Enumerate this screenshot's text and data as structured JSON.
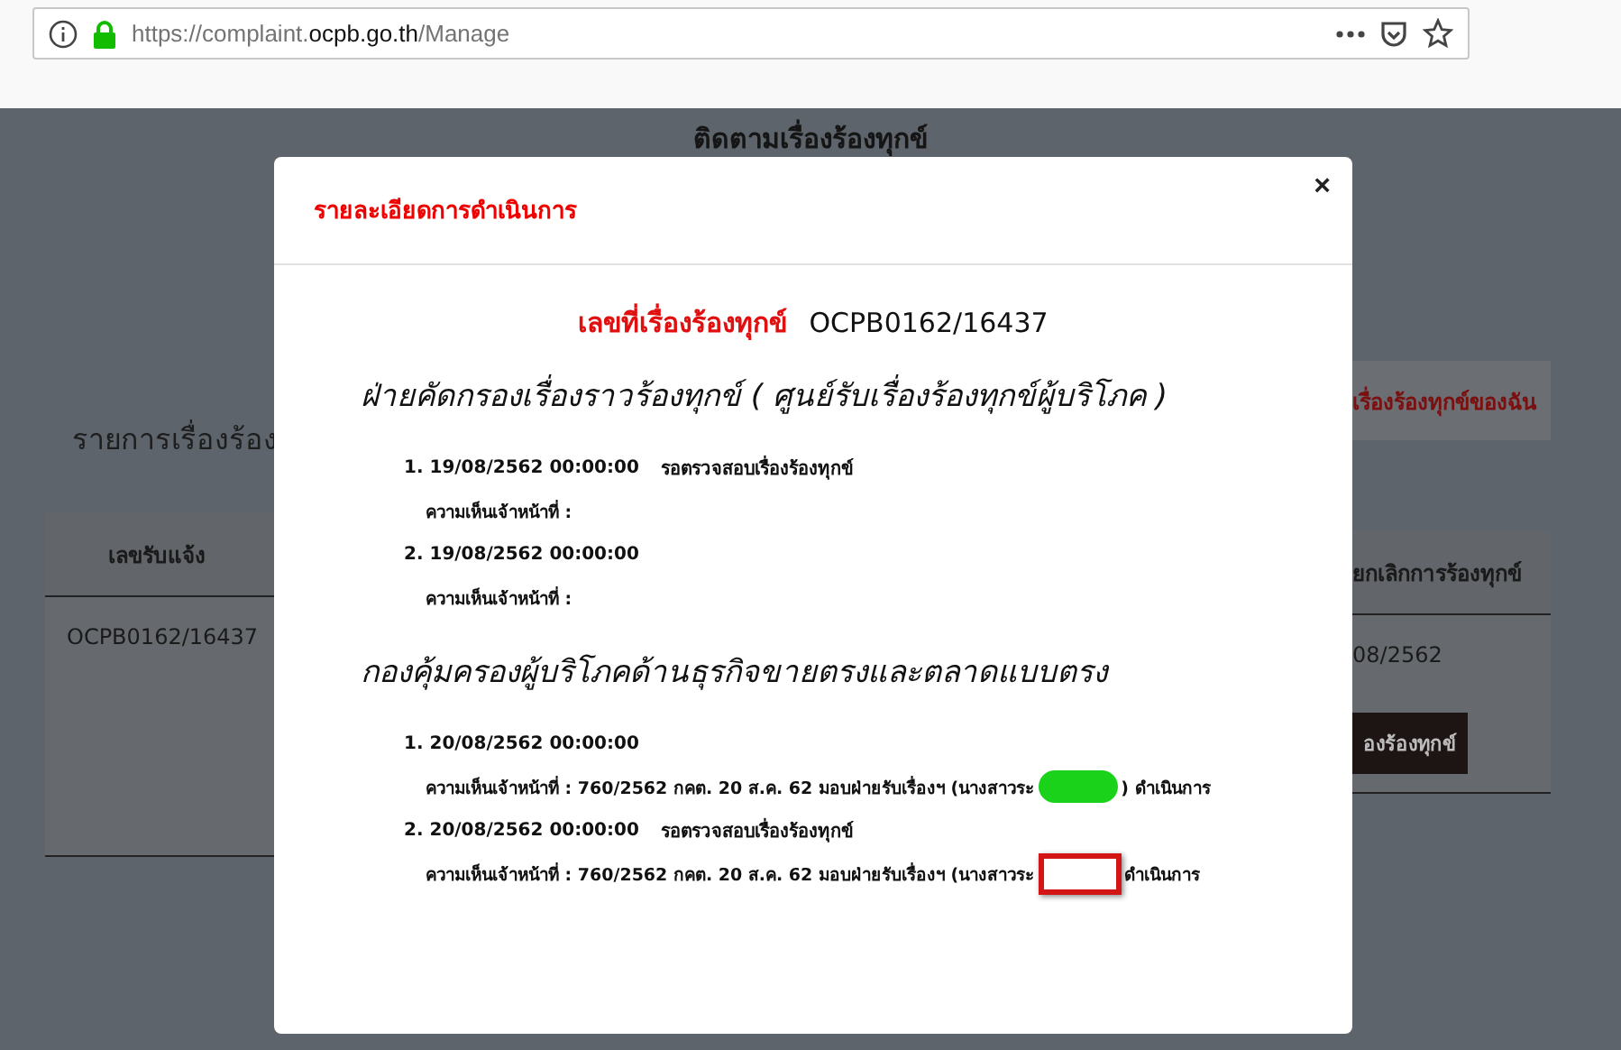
{
  "browser": {
    "url_prefix": "https://complaint.",
    "url_domain": "ocpb.go.th",
    "url_path": "/Manage",
    "secure": true
  },
  "page": {
    "title": "ติดตามเรื่องร้องทุกข์",
    "list_heading": "รายการเรื่องร้อง",
    "my_tab": "เรื่องร้องทุกข์ของฉัน",
    "columns": [
      "เลขรับแจ้ง",
      "ยกเลิกการร้องทุกข์"
    ],
    "row": [
      "OCPB0162/16437",
      "08/2562"
    ],
    "row_button": "องร้องทุกข์"
  },
  "modal": {
    "title": "รายละเอียดการดำเนินการ",
    "close": "×",
    "complaint_label": "เลขที่เรื่องร้องทุกข์",
    "complaint_number": "OCPB0162/16437",
    "sections": [
      {
        "title": "ฝ่ายคัดกรองเรื่องราวร้องทุกข์ ( ศูนย์รับเรื่องร้องทุกข์ผู้บริโภค )",
        "entries": [
          {
            "heading": "1. 19/08/2562 00:00:00",
            "status": "รอตรวจสอบเรื่องร้องทุกข์",
            "comment": "ความเห็นเจ้าหน้าที่ :"
          },
          {
            "heading": "2. 19/08/2562 00:00:00",
            "comment": "ความเห็นเจ้าหน้าที่ :"
          }
        ]
      },
      {
        "title": "กองคุ้มครองผู้บริโภคด้านธุรกิจขายตรงและตลาดแบบตรง",
        "entries": [
          {
            "heading": "1. 20/08/2562 00:00:00",
            "comment": "ความเห็นเจ้าหน้าที่ : 760/2562 กคต. 20 ส.ค. 62 มอบฝ่ายรับเรื่องฯ (นางสาวระ",
            "redaction": {
              "kind": "blob",
              "color": "#19d219"
            },
            "comment_after": ") ดำเนินการ"
          },
          {
            "heading": "2. 20/08/2562 00:00:00",
            "status": "รอตรวจสอบเรื่องร้องทุกข์",
            "comment": "ความเห็นเจ้าหน้าที่ : 760/2562 กคต. 20 ส.ค. 62 มอบฝ่ายรับเรื่องฯ (นางสาวระ",
            "redaction": {
              "kind": "box",
              "color": "#d31515"
            },
            "comment_after": "ดำเนินการ"
          }
        ]
      }
    ]
  }
}
